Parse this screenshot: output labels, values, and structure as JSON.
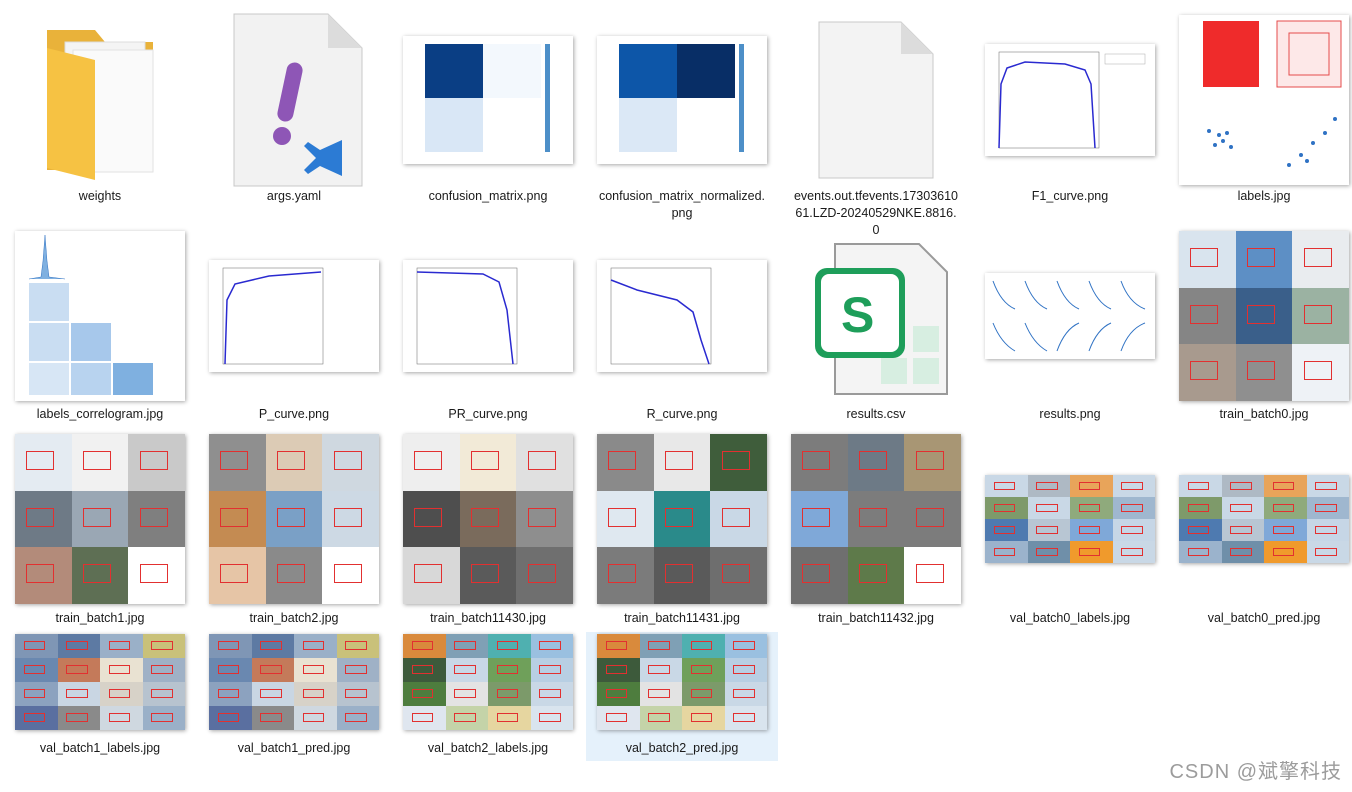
{
  "files": [
    {
      "name": "weights",
      "icon": "folder-icon"
    },
    {
      "name": "args.yaml",
      "icon": "yaml-file-icon"
    },
    {
      "name": "confusion_matrix.png",
      "icon": "image-thumbnail"
    },
    {
      "name": "confusion_matrix_normalized.png",
      "icon": "image-thumbnail"
    },
    {
      "name": "events.out.tfevents.1730361061.LZD-20240529NKE.8816.0",
      "icon": "blank-file-icon"
    },
    {
      "name": "F1_curve.png",
      "icon": "image-thumbnail"
    },
    {
      "name": "labels.jpg",
      "icon": "image-thumbnail"
    },
    {
      "name": "labels_correlogram.jpg",
      "icon": "image-thumbnail"
    },
    {
      "name": "P_curve.png",
      "icon": "image-thumbnail"
    },
    {
      "name": "PR_curve.png",
      "icon": "image-thumbnail"
    },
    {
      "name": "R_curve.png",
      "icon": "image-thumbnail"
    },
    {
      "name": "results.csv",
      "icon": "spreadsheet-file-icon"
    },
    {
      "name": "results.png",
      "icon": "image-thumbnail"
    },
    {
      "name": "train_batch0.jpg",
      "icon": "image-thumbnail"
    },
    {
      "name": "train_batch1.jpg",
      "icon": "image-thumbnail"
    },
    {
      "name": "train_batch2.jpg",
      "icon": "image-thumbnail"
    },
    {
      "name": "train_batch11430.jpg",
      "icon": "image-thumbnail"
    },
    {
      "name": "train_batch11431.jpg",
      "icon": "image-thumbnail"
    },
    {
      "name": "train_batch11432.jpg",
      "icon": "image-thumbnail"
    },
    {
      "name": "val_batch0_labels.jpg",
      "icon": "image-thumbnail"
    },
    {
      "name": "val_batch0_pred.jpg",
      "icon": "image-thumbnail"
    },
    {
      "name": "val_batch1_labels.jpg",
      "icon": "image-thumbnail"
    },
    {
      "name": "val_batch1_pred.jpg",
      "icon": "image-thumbnail"
    },
    {
      "name": "val_batch2_labels.jpg",
      "icon": "image-thumbnail"
    },
    {
      "name": "val_batch2_pred.jpg",
      "icon": "image-thumbnail",
      "selected": true
    }
  ],
  "watermark": "CSDN @斌擎科技",
  "colors": {
    "selection": "#e5f1fb",
    "folder": "#f6c243",
    "spreadsheet": "#1e9e5a",
    "vscode": "#2c7bd4"
  }
}
